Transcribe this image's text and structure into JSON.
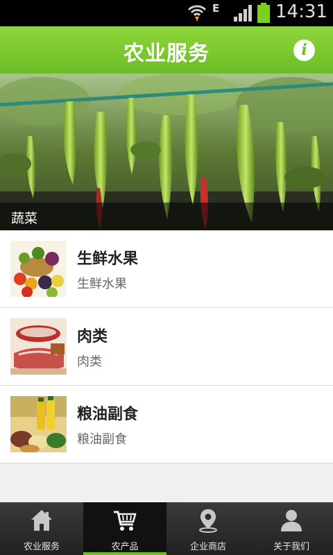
{
  "status_bar": {
    "network_type": "E",
    "time": "14:31"
  },
  "header": {
    "title": "农业服务",
    "info_icon": "info-icon"
  },
  "banner": {
    "caption": "蔬菜"
  },
  "categories": [
    {
      "name": "生鲜水果",
      "desc": "生鲜水果",
      "icon": "fruit-image"
    },
    {
      "name": "肉类",
      "desc": "肉类",
      "icon": "meat-image"
    },
    {
      "name": "粮油副食",
      "desc": "粮油副食",
      "icon": "grain-oil-image"
    }
  ],
  "tabs": [
    {
      "label": "农业服务",
      "icon": "home-icon",
      "active": false
    },
    {
      "label": "农产品",
      "icon": "cart-icon",
      "active": true
    },
    {
      "label": "企业商店",
      "icon": "location-pin-icon",
      "active": false
    },
    {
      "label": "关于我们",
      "icon": "person-icon",
      "active": false
    }
  ],
  "colors": {
    "header_green": "#6cbd26",
    "tabbar_dark": "#222222",
    "active_indicator": "#6cbd26"
  }
}
